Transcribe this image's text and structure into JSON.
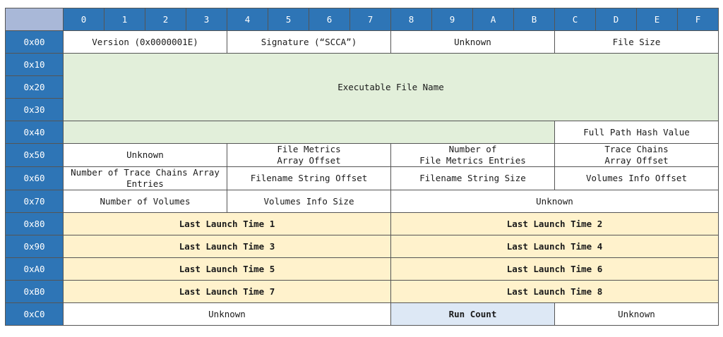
{
  "column_headers": [
    "0",
    "1",
    "2",
    "3",
    "4",
    "5",
    "6",
    "7",
    "8",
    "9",
    "A",
    "B",
    "C",
    "D",
    "E",
    "F"
  ],
  "rows": {
    "r00": {
      "offset": "0x00",
      "version": "Version (0x0000001E)",
      "signature": "Signature (“SCCA”)",
      "unknown": "Unknown",
      "file_size": "File Size"
    },
    "r10": {
      "offset": "0x10",
      "executable_file_name": "Executable File Name"
    },
    "r20": {
      "offset": "0x20"
    },
    "r30": {
      "offset": "0x30"
    },
    "r40": {
      "offset": "0x40",
      "full_path_hash": "Full Path Hash Value"
    },
    "r50": {
      "offset": "0x50",
      "unknown": "Unknown",
      "file_metrics_offset": "File Metrics\nArray Offset",
      "num_file_metrics": "Number of\nFile Metrics Entries",
      "trace_chains_offset": "Trace Chains\nArray Offset"
    },
    "r60": {
      "offset": "0x60",
      "num_trace_chains": "Number of Trace Chains Array\nEntries",
      "filename_string_offset": "Filename String Offset",
      "filename_string_size": "Filename String Size",
      "volumes_info_offset": "Volumes Info Offset"
    },
    "r70": {
      "offset": "0x70",
      "num_volumes": "Number of Volumes",
      "volumes_info_size": "Volumes Info Size",
      "unknown": "Unknown"
    },
    "r80": {
      "offset": "0x80",
      "left": "Last Launch Time 1",
      "right": "Last Launch Time 2"
    },
    "r90": {
      "offset": "0x90",
      "left": "Last Launch Time 3",
      "right": "Last Launch Time 4"
    },
    "rA0": {
      "offset": "0xA0",
      "left": "Last Launch Time 5",
      "right": "Last Launch Time 6"
    },
    "rB0": {
      "offset": "0xB0",
      "left": "Last Launch Time 7",
      "right": "Last Launch Time 8"
    },
    "rC0": {
      "offset": "0xC0",
      "unknown_left": "Unknown",
      "run_count": "Run Count",
      "unknown_right": "Unknown"
    }
  },
  "colors": {
    "header_blue": "#2e75b6",
    "corner": "#a9b8d8",
    "name_green": "#e2efda",
    "launch_tan": "#fff2cc",
    "run_count_blue": "#dde8f5"
  }
}
